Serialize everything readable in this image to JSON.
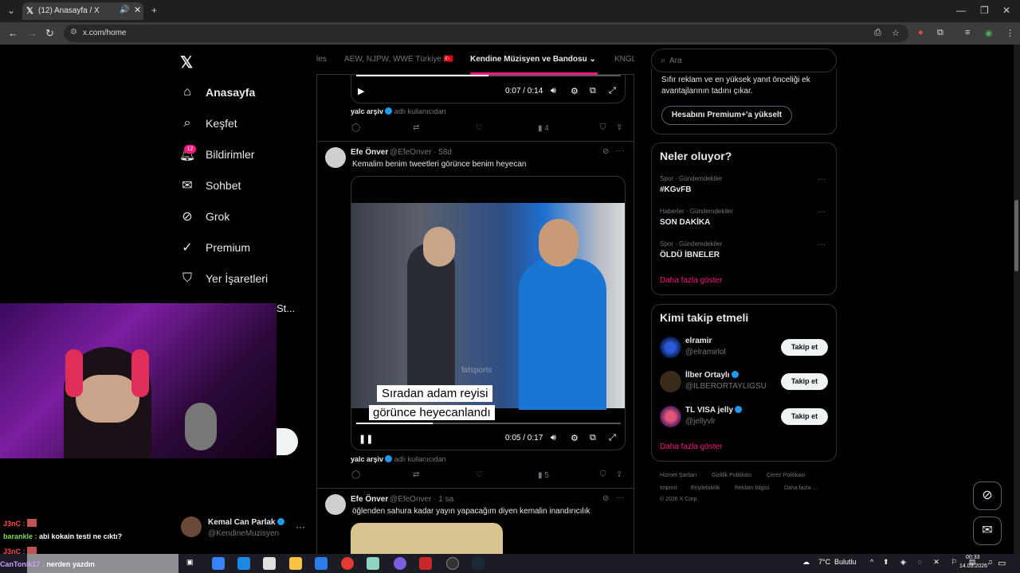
{
  "browser": {
    "tab_title": "(12) Anasayfa / X",
    "url": "x.com/home"
  },
  "nav": {
    "items": [
      {
        "label": "Anasayfa",
        "icon": "home-icon"
      },
      {
        "label": "Keşfet",
        "icon": "search-icon"
      },
      {
        "label": "Bildirimler",
        "icon": "bell-icon"
      },
      {
        "label": "Sohbet",
        "icon": "mail-icon"
      },
      {
        "label": "Grok",
        "icon": "grok-icon"
      },
      {
        "label": "Premium",
        "icon": "premium-icon"
      },
      {
        "label": "Yer İşaretleri",
        "icon": "bookmark-icon"
      }
    ],
    "notif_count": "12",
    "truncated_label": "St...",
    "account_name": "Kemal Can Parlak",
    "account_handle": "@KendineMuzisyen"
  },
  "topics": {
    "partial_left": "les",
    "item1": "AEW, NJPW, WWE Türkiye 🇹🇷",
    "active": "Kendine Müzisyen ve Bandosu",
    "partial_right": "KNGL"
  },
  "tweet0": {
    "time": "0:07 / 0:14",
    "source_name": "yalc arşiv",
    "source_suffix": "adlı kullanıcıdan",
    "views": "4"
  },
  "tweet1": {
    "name": "Efe Önver",
    "handle": "@EfeOnver",
    "age": "58d",
    "text": "Kemalim benim tweetleri görünce benim heyecan",
    "caption_line1": "Sıradan adam reyisi",
    "caption_line2": "görünce heyecanlandı",
    "watermark": "fatsports",
    "time": "0:05 / 0:17",
    "source_name": "yalc arşiv",
    "source_suffix": "adlı kullanıcıdan",
    "views": "5"
  },
  "tweet2": {
    "name": "Efe Önver",
    "handle": "@EfeOnver",
    "age": "1 sa",
    "text": "öğlenden sahura kadar yayın yapacağım diyen kemalin inandırıcılık"
  },
  "right": {
    "search_placeholder": "Ara",
    "premium_text": "Sıfır reklam ve en yüksek yanıt önceliği ek avantajlarının tadını çıkar.",
    "premium_button": "Hesabını Premium+'a yükselt",
    "trends_title": "Neler oluyor?",
    "trends": [
      {
        "meta": "Spor · Gündemdekiler",
        "name": "#KGvFB"
      },
      {
        "meta": "Haberler · Gündemdekiler",
        "name": "SON DAKİKA"
      },
      {
        "meta": "Spor · Gündemdekiler",
        "name": "ÖLDÜ İBNELER"
      }
    ],
    "trends_more": "Daha fazla göster",
    "who_title": "Kimi takip etmeli",
    "who": [
      {
        "name": "elramir",
        "handle": "@elramirlol",
        "button": "Takip et"
      },
      {
        "name": "İlber Ortaylı",
        "handle": "@ILBERORTAYLIGSU",
        "button": "Takip et"
      },
      {
        "name": "TL VISA jelly",
        "handle": "@jellyvlr",
        "button": "Takip et"
      }
    ],
    "who_more": "Daha fazla göster",
    "footer": [
      "Hizmet Şartları",
      "Gizlilik Politikası",
      "Çerez Politikası",
      "Imprint",
      "Erişilebilirlik",
      "Reklam bilgisi",
      "Daha fazla ...",
      "© 2026 X Corp."
    ]
  },
  "chat": [
    {
      "user": "J3nC :",
      "text": "",
      "color": "#ff4d4d"
    },
    {
      "user": "barankle :",
      "text": "abi kokain testi ne cıktı?",
      "color": "#7bd85a"
    },
    {
      "user": "J3nC :",
      "text": "",
      "color": "#ff4d4d"
    },
    {
      "user": "CanTonik17 :",
      "text": "nerden yazdın",
      "color": "#c9a0ff"
    }
  ],
  "taskbar": {
    "weather_temp": "7°C",
    "weather_text": "Bulutlu",
    "time": "00:33",
    "date": "14.03.2026"
  },
  "colors": {
    "accent": "#f91880",
    "verified": "#1d9bf0",
    "background": "#000000",
    "border": "#2f3336"
  }
}
